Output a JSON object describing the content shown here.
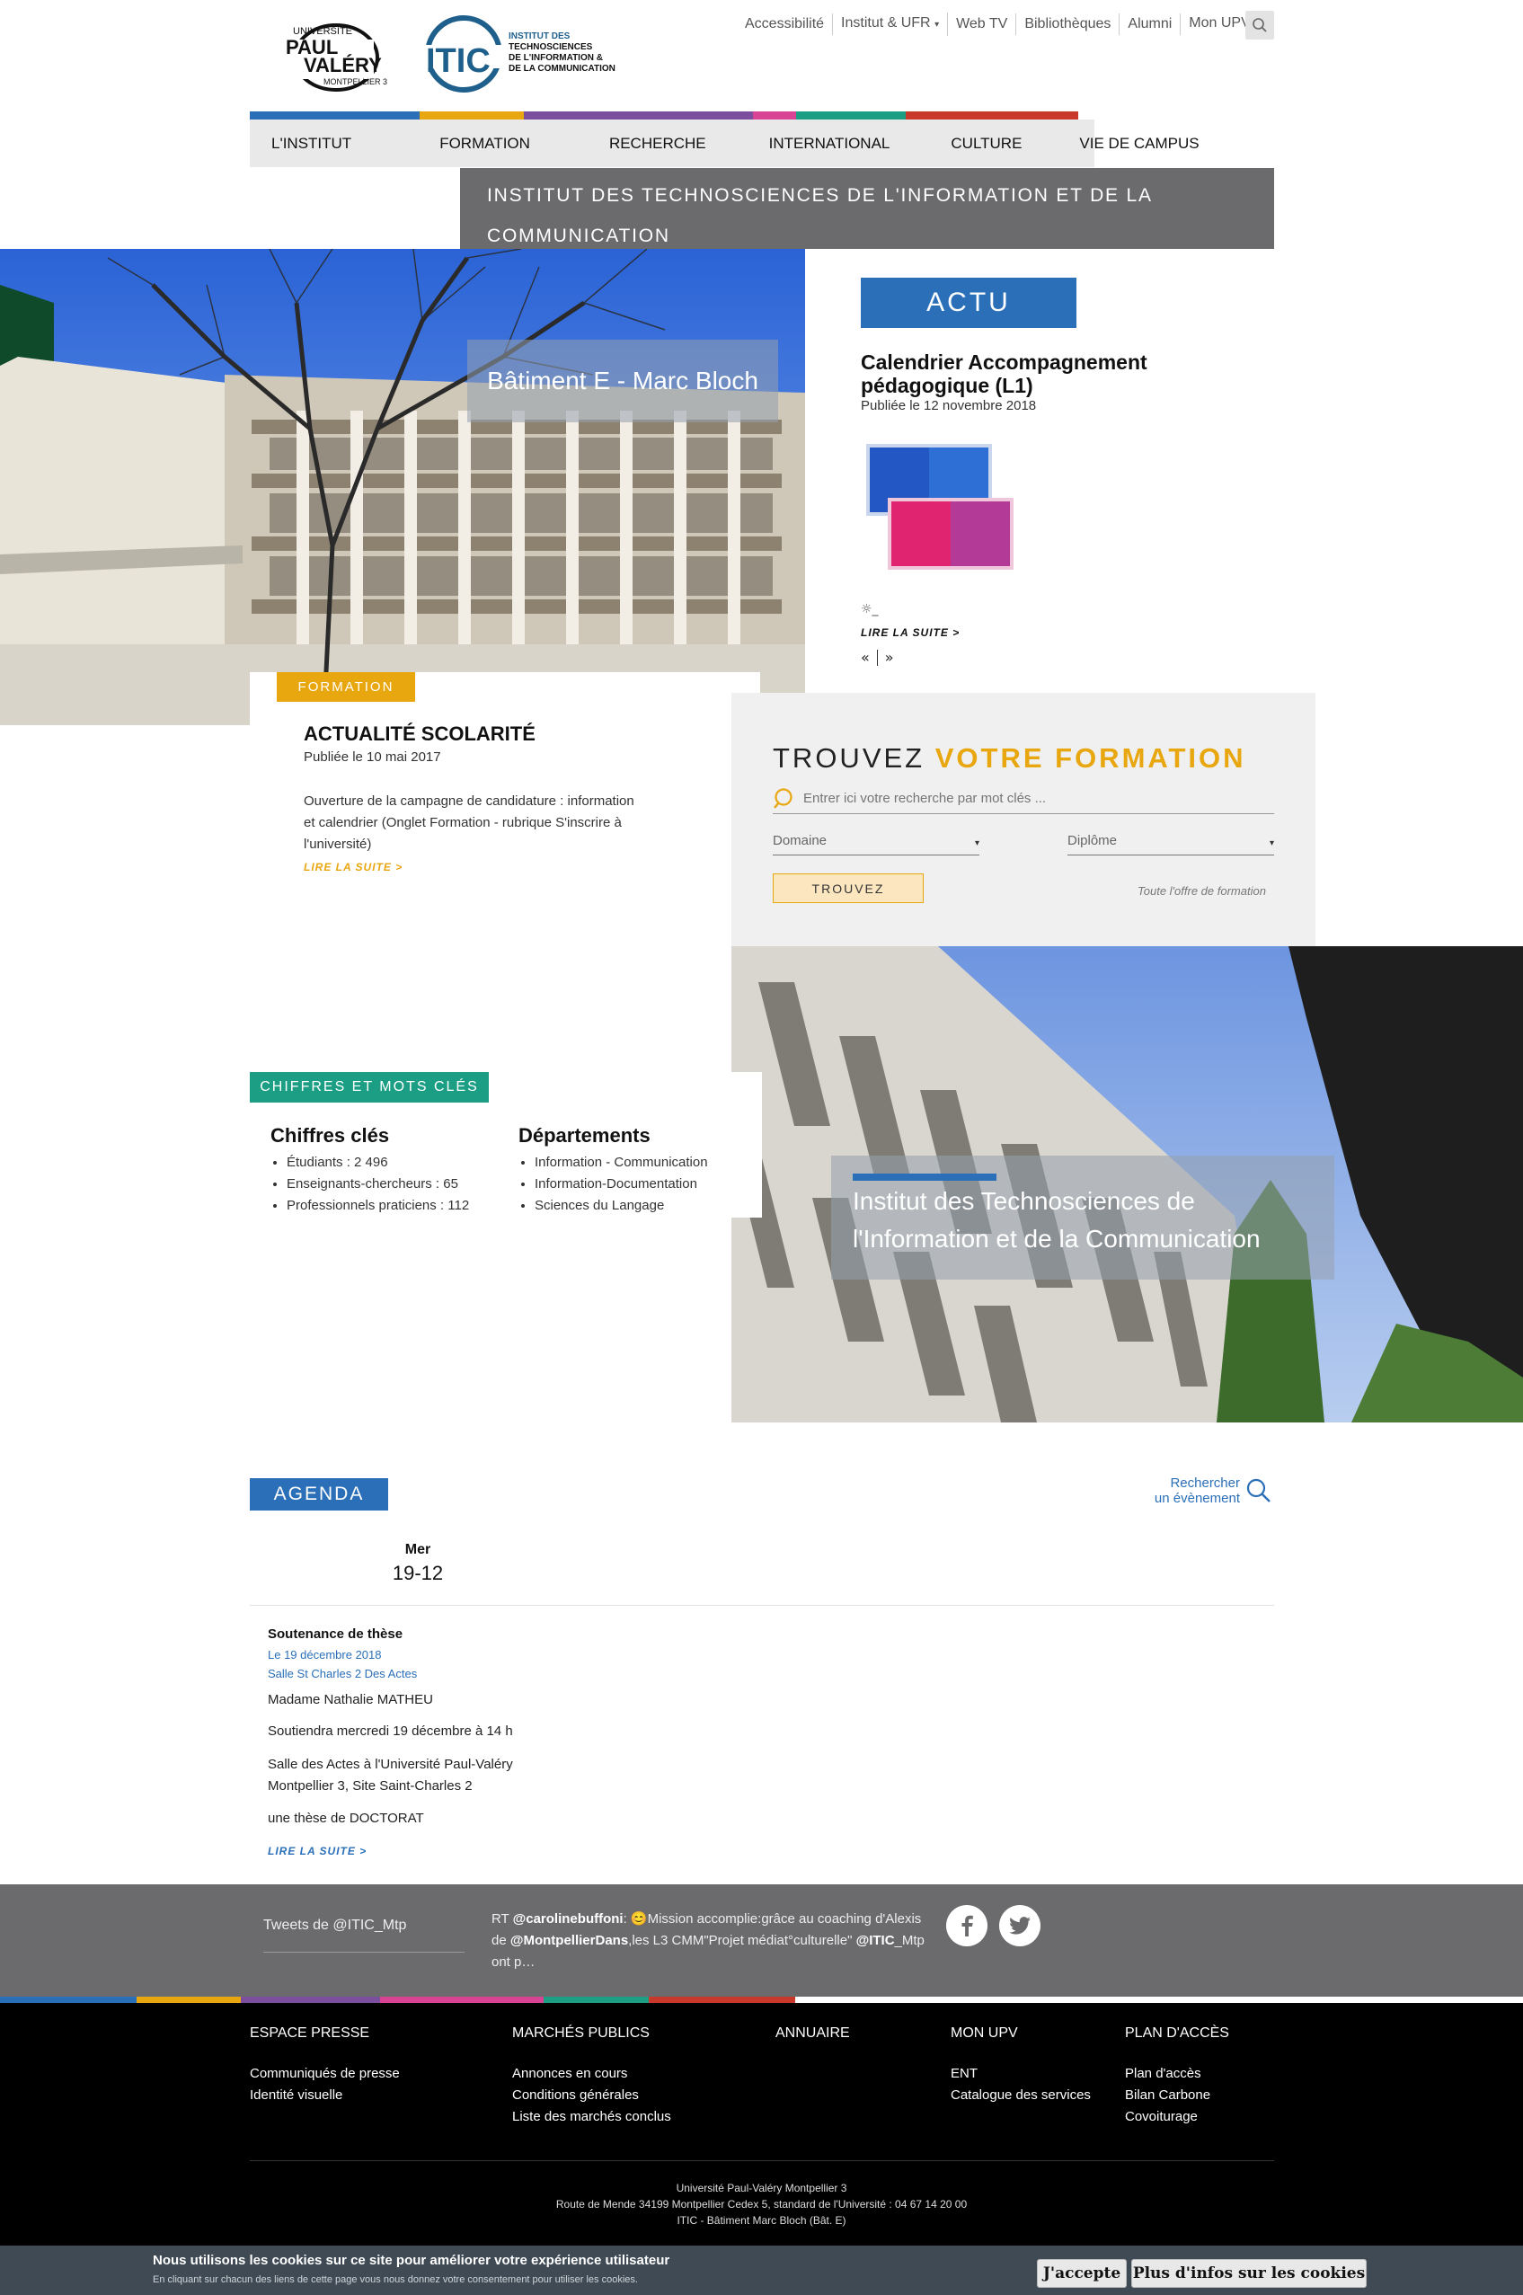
{
  "header": {
    "upv_logo": {
      "line1": "UNIVERSITÉ",
      "line2": "PAUL",
      "line3": "VALÉRY",
      "line4": "MONTPELLIER 3"
    },
    "itic_logo": {
      "mark": "ITIC",
      "line1": "INSTITUT DES",
      "line2": "TECHNOSCIENCES",
      "line3": "DE L'INFORMATION &",
      "line4": "DE LA COMMUNICATION"
    },
    "utility_links": [
      {
        "label": "Accessibilité"
      },
      {
        "label": "Institut & UFR",
        "dropdown": true
      },
      {
        "label": "Web TV"
      },
      {
        "label": "Bibliothèques"
      },
      {
        "label": "Alumni"
      },
      {
        "label": "Mon UPV",
        "dropdown": true
      }
    ],
    "search_icon": "search-icon"
  },
  "brand_colors": [
    "#2b6fb8",
    "#e8a60f",
    "#7b4f9e",
    "#d94393",
    "#1b9e84",
    "#c8392b"
  ],
  "main_nav": [
    {
      "label": "L'INSTITUT"
    },
    {
      "label": "FORMATION"
    },
    {
      "label": "RECHERCHE"
    },
    {
      "label": "INTERNATIONAL"
    },
    {
      "label": "CULTURE"
    },
    {
      "label": "VIE DE CAMPUS"
    }
  ],
  "institute_title": "INSTITUT DES TECHNOSCIENCES DE L'INFORMATION ET DE LA COMMUNICATION",
  "hero": {
    "caption": "Bâtiment E - Marc Bloch"
  },
  "actu": {
    "badge": "ACTU",
    "title": "Calendrier Accompagnement pédagogique (L1)",
    "date": "Publiée le 12 novembre 2018",
    "excerpt": "☼_",
    "read_more": "LIRE LA SUITE  >",
    "prev": "«",
    "next": "»"
  },
  "formation_news": {
    "badge": "FORMATION",
    "title": "ACTUALITÉ SCOLARITÉ",
    "date": "Publiée le 10 mai 2017",
    "text": " Ouverture de la campagne de candidature : information et calendrier (Onglet Formation - rubrique S'inscrire à l'université)",
    "read_more": "LIRE LA SUITE  >"
  },
  "trouvez": {
    "title_part1": "TROUVEZ ",
    "title_part2": "VOTRE FORMATION",
    "search_placeholder": "Entrer ici votre recherche par mot clés ...",
    "domaine_label": "Domaine",
    "diplome_label": "Diplôme",
    "button": "TROUVEZ",
    "all_offer": "Toute l'offre de formation"
  },
  "photo2": {
    "caption": "Institut des Technosciences de l'Information et de la Communication"
  },
  "chiffres": {
    "badge": "CHIFFRES ET MOTS CLÉS",
    "col1_title": "Chiffres clés",
    "col1_items": [
      "Étudiants : 2 496",
      "Enseignants-chercheurs : 65",
      "Professionnels praticiens : 112"
    ],
    "col2_title": "Départements",
    "col2_items": [
      "Information - Communication",
      "Information-Documentation",
      "Sciences du Langage"
    ]
  },
  "agenda": {
    "badge": "AGENDA",
    "search_line1": "Rechercher",
    "search_line2": "un évènement",
    "day_name": "Mer",
    "day_num": "19-12",
    "event": {
      "title": "Soutenance de thèse",
      "date": "Le 19 décembre 2018",
      "place": "Salle St Charles 2 Des Actes",
      "p1": "Madame Nathalie MATHEU",
      "p2": "Soutiendra mercredi 19 décembre à 14 h",
      "p3": "Salle des Actes à l'Université Paul-Valéry Montpellier 3, Site Saint-Charles 2",
      "p4": "une thèse de DOCTORAT",
      "read_more": "LIRE LA SUITE  >"
    }
  },
  "twitter": {
    "label": "Tweets de @ITIC_Mtp",
    "rt": "RT ",
    "handle1": "@carolinebuffoni",
    "part1": ": 😊Mission accomplie:grâce au coaching d'Alexis de ",
    "handle2": "@MontpellierDans",
    "part2": ",les L3 CMM\"Projet médiat°culturelle\" ",
    "handle3": "@ITIC",
    "part3": "_Mtp ont p…",
    "facebook_icon": "facebook-icon",
    "twitter_icon": "twitter-icon"
  },
  "footer": {
    "cols": [
      {
        "title": "ESPACE PRESSE",
        "links": [
          "Communiqués de presse",
          "Identité visuelle"
        ]
      },
      {
        "title": "MARCHÉS PUBLICS",
        "links": [
          "Annonces en cours",
          "Conditions générales",
          "Liste des marchés conclus"
        ]
      },
      {
        "title": "ANNUAIRE",
        "links": []
      },
      {
        "title": "MON UPV",
        "links": [
          "ENT",
          "Catalogue des services"
        ]
      },
      {
        "title": "PLAN D'ACCÈS",
        "links": [
          "Plan d'accès",
          "Bilan Carbone",
          "Covoiturage"
        ]
      }
    ],
    "addr1": "Université Paul-Valéry Montpellier 3",
    "addr2": "Route de Mende 34199 Montpellier Cedex 5, standard de l'Université : 04 67 14 20 00",
    "addr3": "ITIC - Bâtiment Marc Bloch (Bât. E)"
  },
  "cookie": {
    "title": "Nous utilisons les cookies sur ce site pour améliorer votre expérience utilisateur",
    "sub": "En cliquant sur chacun des liens de cette page vous nous donnez votre consentement pour utiliser les cookies.",
    "accept": "J'accepte",
    "more": "Plus d'infos sur les cookies"
  }
}
